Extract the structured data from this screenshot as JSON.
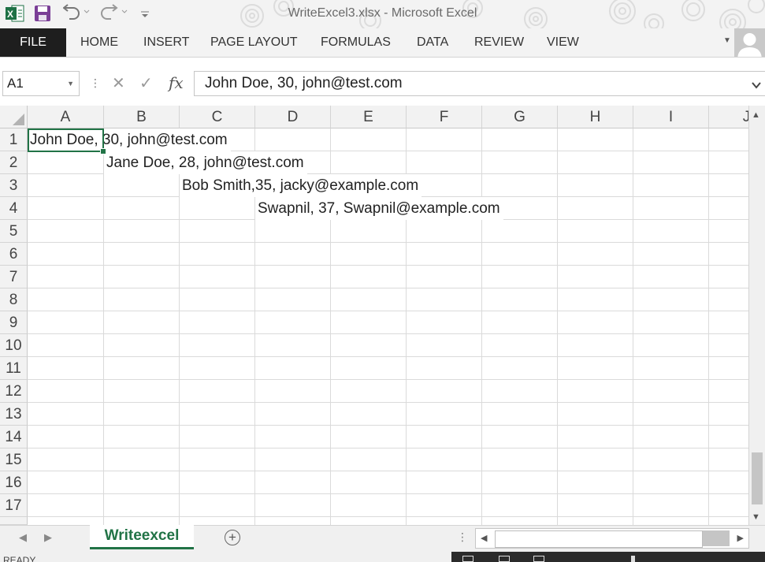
{
  "window": {
    "title": "WriteExcel3.xlsx - Microsoft Excel"
  },
  "qat": {
    "icons": [
      "excel-logo-icon",
      "save-icon",
      "undo-icon",
      "redo-icon",
      "customize-qat-icon"
    ]
  },
  "ribbon": {
    "file_label": "FILE",
    "tabs": [
      "HOME",
      "INSERT",
      "PAGE LAYOUT",
      "FORMULAS",
      "DATA",
      "REVIEW",
      "VIEW"
    ]
  },
  "formula_bar": {
    "name_box": "A1",
    "fx_label": "fx",
    "value": "John Doe, 30, john@test.com"
  },
  "sheet": {
    "columns": [
      "A",
      "B",
      "C",
      "D",
      "E",
      "F",
      "G",
      "H",
      "I",
      "J"
    ],
    "rows": [
      "1",
      "2",
      "3",
      "4",
      "5",
      "6",
      "7",
      "8",
      "9",
      "10",
      "11",
      "12",
      "13",
      "14",
      "15",
      "16",
      "17"
    ],
    "cells": [
      {
        "ref": "A1",
        "value": "John Doe, 30, john@test.com"
      },
      {
        "ref": "B2",
        "value": "Jane Doe, 28, john@test.com"
      },
      {
        "ref": "C3",
        "value": "Bob Smith,35, jacky@example.com"
      },
      {
        "ref": "D4",
        "value": "Swapnil, 37, Swapnil@example.com"
      }
    ],
    "active_cell": "A1"
  },
  "sheet_tabs": {
    "tabs": [
      "Writeexcel"
    ],
    "active": "Writeexcel"
  },
  "status": {
    "text": "READY"
  },
  "colors": {
    "accent": "#217346",
    "file_tab_bg": "#1e1e1e",
    "header_bg": "#f2f2f2"
  }
}
